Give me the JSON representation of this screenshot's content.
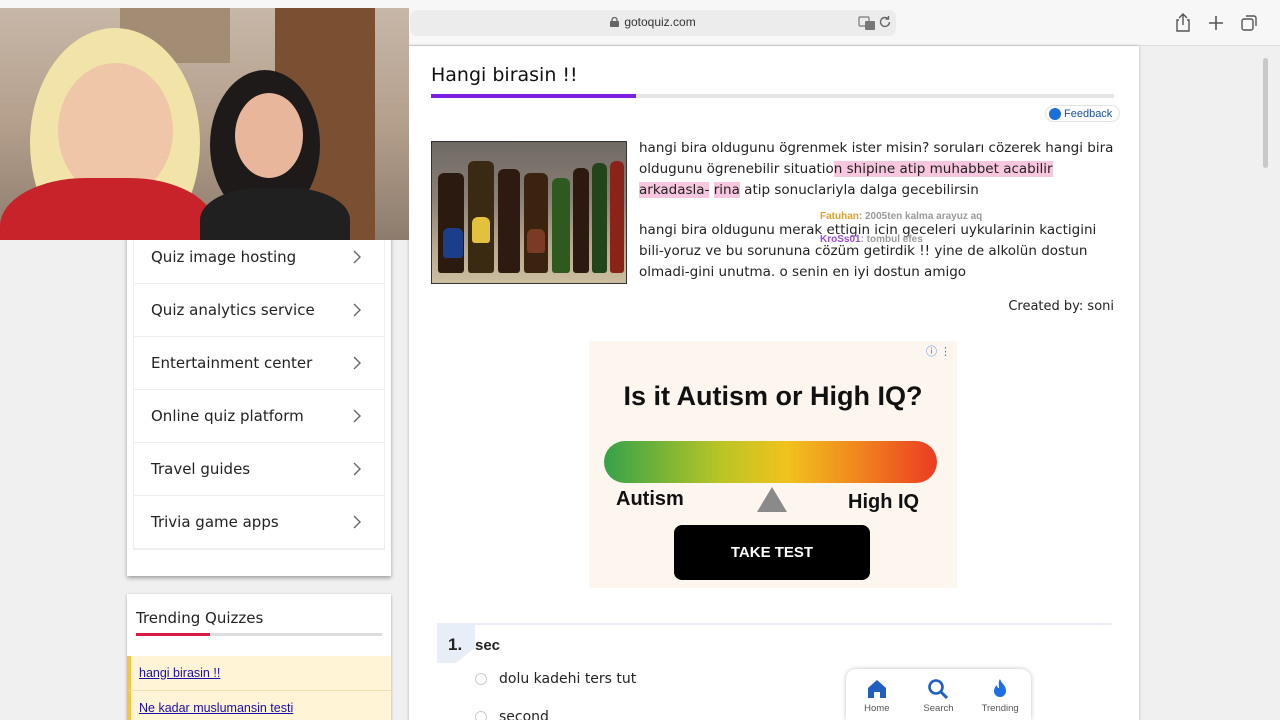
{
  "browser": {
    "url": "gotoquiz.com"
  },
  "sidebar": {
    "items": [
      {
        "label": "Quiz image hosting"
      },
      {
        "label": "Quiz analytics service"
      },
      {
        "label": "Entertainment center"
      },
      {
        "label": "Online quiz platform"
      },
      {
        "label": "Travel guides"
      },
      {
        "label": "Trivia game apps"
      }
    ]
  },
  "trending": {
    "title": "Trending Quizzes",
    "items": [
      {
        "label": "hangi birasin !!"
      },
      {
        "label": "Ne kadar muslumansin testi"
      }
    ]
  },
  "quiz": {
    "title": "Hangi birasin !!",
    "feedback_label": "Feedback",
    "desc1_a": "hangi bira oldugunu ögrenmek ister misin? soruları cözerek hangi bira oldugunu ögrenebilir situatio",
    "desc1_hl1": "n shipine atip muhabbet acabilir arkadasla-",
    "desc1_hl2": "rina",
    "desc1_b": " atip sonuclariyla dalga gecebilirsin",
    "desc2": "hangi bira oldugunu merak ettigin icin geceleri uykularinin kactigini bili-yoruz ve bu sorununa cözüm getirdik !! yine de alkolün dostun olmadi-gini unutma. o senin en iyi dostun amigo",
    "created_by": "Created by: soni"
  },
  "ad": {
    "title": "Is it Autism or High IQ?",
    "left_label": "Autism",
    "right_label": "High IQ",
    "button": "TAKE TEST"
  },
  "question": {
    "number": "1.",
    "text": "sec",
    "options": [
      {
        "label": "dolu kadehi ters tut"
      },
      {
        "label": "second"
      }
    ]
  },
  "bottom_nav": {
    "home": "Home",
    "search": "Search",
    "trending": "Trending"
  },
  "chat": [
    {
      "user": "Fatuhan",
      "message": ": 2005ten kalma arayuz aq",
      "color": "#e0a030"
    },
    {
      "user": "KroSs01",
      "message": ": tombul efes",
      "color": "#9a4be0"
    }
  ]
}
